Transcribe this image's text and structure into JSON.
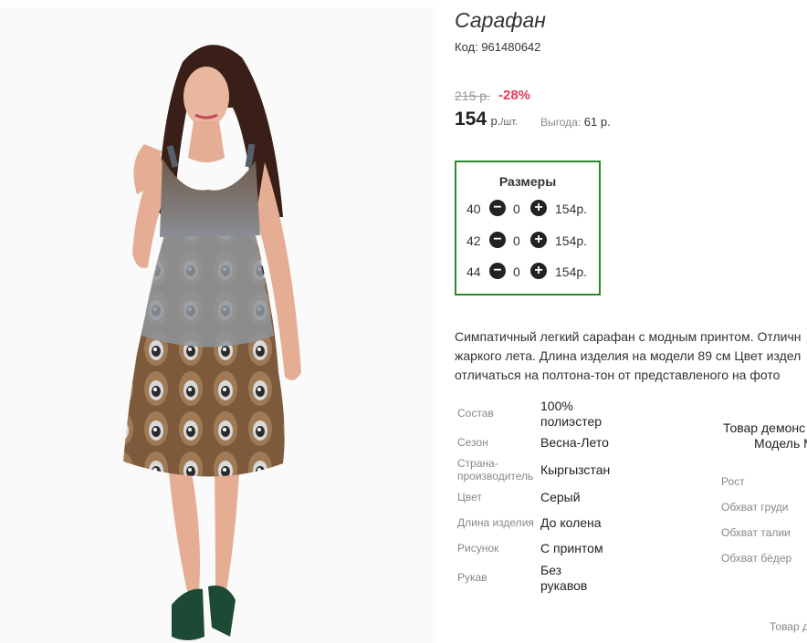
{
  "product": {
    "title": "Сарафан",
    "code": "Код: 961480642",
    "old_price": "215 р.",
    "discount": "-28%",
    "price": "154",
    "price_unit": "р.",
    "price_unit_small": "/шт.",
    "benefit_label": "Выгода:",
    "benefit_value": "61 р."
  },
  "sizes": {
    "title": "Размеры",
    "rows": [
      {
        "size": "40",
        "qty": "0",
        "price": "154р."
      },
      {
        "size": "42",
        "qty": "0",
        "price": "154р."
      },
      {
        "size": "44",
        "qty": "0",
        "price": "154р."
      }
    ],
    "minus_icon": "minus-circle-icon",
    "plus_icon": "plus-circle-icon"
  },
  "description": {
    "lines": [
      "Симпатичный легкий сарафан с модным принтом. Отличн",
      "жаркого лета. Длина изделия на модели 89 см Цвет издел",
      "отличаться на полтона-тон от представленого на фото"
    ]
  },
  "attributes": [
    {
      "label": "Состав",
      "value": "100%\nполиэстер"
    },
    {
      "label": "Сезон",
      "value": "Весна-Лето"
    },
    {
      "label": "Страна-\nпроизводитель",
      "value": "Кыргызстан"
    },
    {
      "label": "Цвет",
      "value": "Серый"
    },
    {
      "label": "Длина изделия",
      "value": "До колена"
    },
    {
      "label": "Рисунок",
      "value": "С принтом"
    },
    {
      "label": "Рукав",
      "value": "Без\nрукавов"
    }
  ],
  "model": {
    "demo_title": "Товар демонс",
    "name": "Модель М",
    "params": [
      "Рост",
      "Обхват груди",
      "Обхват талии",
      "Обхват бёдер"
    ],
    "note": "Товар д"
  },
  "colors": {
    "accent_discount": "#e8385a",
    "sizes_border": "#2a8a2a",
    "cart_button": "#d9ef3c"
  }
}
